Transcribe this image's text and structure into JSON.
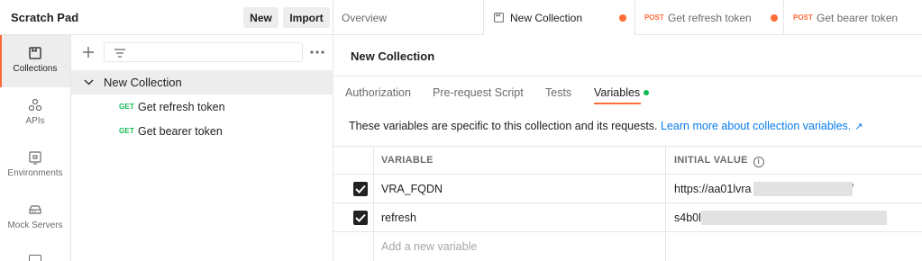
{
  "workspace": {
    "title": "Scratch Pad",
    "new_label": "New",
    "import_label": "Import"
  },
  "sidebar": {
    "items": [
      {
        "label": "Collections",
        "icon": "collections-icon",
        "active": true
      },
      {
        "label": "APIs",
        "icon": "apis-icon"
      },
      {
        "label": "Environments",
        "icon": "environments-icon"
      },
      {
        "label": "Mock Servers",
        "icon": "mock-servers-icon"
      }
    ]
  },
  "tree": {
    "collection_name": "New Collection",
    "requests": [
      {
        "method": "GET",
        "name": "Get refresh token"
      },
      {
        "method": "GET",
        "name": "Get bearer token"
      }
    ]
  },
  "tabs": [
    {
      "label": "Overview"
    },
    {
      "label": "New Collection",
      "active": true,
      "unsaved": true
    },
    {
      "method": "POST",
      "label": "Get refresh token",
      "unsaved": true
    },
    {
      "method": "POST",
      "label": "Get bearer token"
    }
  ],
  "main": {
    "title": "New Collection",
    "subtabs": [
      "Authorization",
      "Pre-request Script",
      "Tests",
      "Variables"
    ],
    "active_subtab": "Variables",
    "info_text": "These variables are specific to this collection and its requests.",
    "info_link": "Learn more about collection variables.",
    "info_arrow": "↗",
    "table": {
      "headers": [
        "VARIABLE",
        "INITIAL VALUE"
      ],
      "header_info_icon": "i",
      "rows": [
        {
          "checked": true,
          "variable": "VRA_FQDN",
          "initial_value": "https://aa01lvra",
          "initial_value_tail": "/"
        },
        {
          "checked": true,
          "variable": "refresh",
          "initial_value": "s4b0l"
        }
      ],
      "add_placeholder": "Add a new variable"
    }
  },
  "colors": {
    "accent": "#ff6c37",
    "get_method": "#0cbb52",
    "post_method": "#ff6c37",
    "link": "#097bed"
  }
}
